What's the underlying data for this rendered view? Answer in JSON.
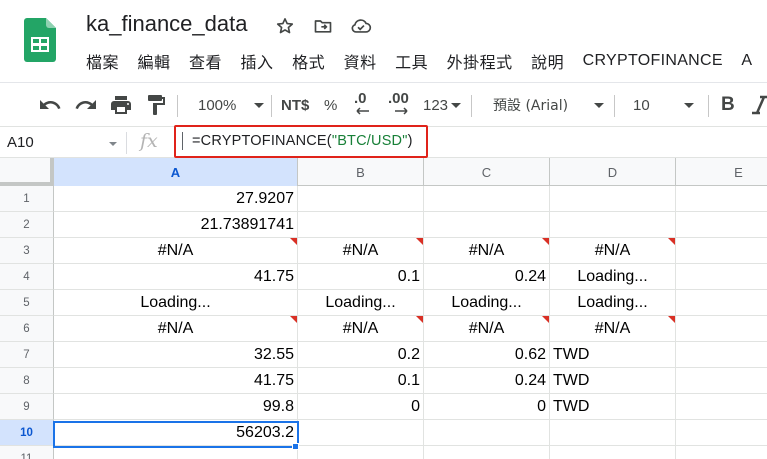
{
  "app": {
    "title": "ka_finance_data",
    "menu": [
      "檔案",
      "編輯",
      "查看",
      "插入",
      "格式",
      "資料",
      "工具",
      "外掛程式",
      "說明",
      "CRYPTOFINANCE",
      "A"
    ],
    "title_icons": [
      "star-icon",
      "move-to-folder-icon",
      "cloud-status-icon"
    ]
  },
  "toolbar": {
    "zoom": "100%",
    "currency": "NT$",
    "percent": "%",
    "decimal_decrease": ".0",
    "decimal_increase": ".00",
    "more_formats": "123",
    "font": "預設 (Arial)",
    "font_size": "10",
    "bold": "B"
  },
  "formula_bar": {
    "cell_ref": "A10",
    "fx": "fx",
    "formula_prefix": "=CRYPTOFINANCE(",
    "formula_arg": "\"BTC/USD\"",
    "formula_suffix": ")",
    "highlight_color": "#e0231a"
  },
  "sheet": {
    "columns": [
      "A",
      "B",
      "C",
      "D",
      "E"
    ],
    "selected_column": "A",
    "selected_row": "10",
    "rows": [
      {
        "num": "1",
        "cells": [
          "27.9207",
          "",
          "",
          ""
        ]
      },
      {
        "num": "2",
        "cells": [
          "21.73891741",
          "",
          "",
          ""
        ]
      },
      {
        "num": "3",
        "cells": [
          "#N/A",
          "#N/A",
          "#N/A",
          "#N/A"
        ]
      },
      {
        "num": "4",
        "cells": [
          "41.75",
          "0.1",
          "0.24",
          "Loading..."
        ]
      },
      {
        "num": "5",
        "cells": [
          "Loading...",
          "Loading...",
          "Loading...",
          "Loading..."
        ]
      },
      {
        "num": "6",
        "cells": [
          "#N/A",
          "#N/A",
          "#N/A",
          "#N/A"
        ]
      },
      {
        "num": "7",
        "cells": [
          "32.55",
          "0.2",
          "0.62",
          "TWD"
        ]
      },
      {
        "num": "8",
        "cells": [
          "41.75",
          "0.1",
          "0.24",
          "TWD"
        ]
      },
      {
        "num": "9",
        "cells": [
          "99.8",
          "0",
          "0",
          "TWD"
        ]
      },
      {
        "num": "10",
        "cells": [
          "56203.2",
          "",
          "",
          ""
        ]
      },
      {
        "num": "11",
        "cells": [
          "",
          "",
          "",
          ""
        ]
      }
    ],
    "error_color": "#d93025",
    "selection_color": "#1a73e8"
  }
}
